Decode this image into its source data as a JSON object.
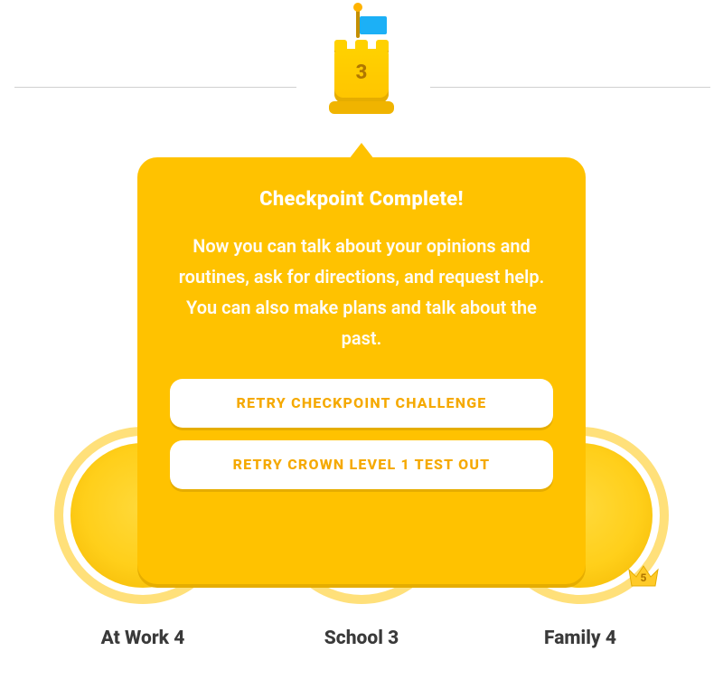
{
  "checkpoint": {
    "number": "3",
    "title": "Checkpoint Complete!",
    "body": "Now you can talk about your opinions and routines, ask for directions, and request help. You can also make plans and talk about the past.",
    "retry_checkpoint_label": "RETRY CHECKPOINT CHALLENGE",
    "retry_crown_label": "RETRY CROWN LEVEL 1 TEST OUT"
  },
  "skills": {
    "left": {
      "label": "At Work 4"
    },
    "mid": {
      "label": "School 3"
    },
    "right": {
      "label": "Family 4",
      "crown_level": "5"
    }
  },
  "colors": {
    "accent": "#ffc200",
    "accent_dark": "#e6ad00",
    "flag": "#1cb0f6",
    "text_dark": "#3a3a3a"
  }
}
